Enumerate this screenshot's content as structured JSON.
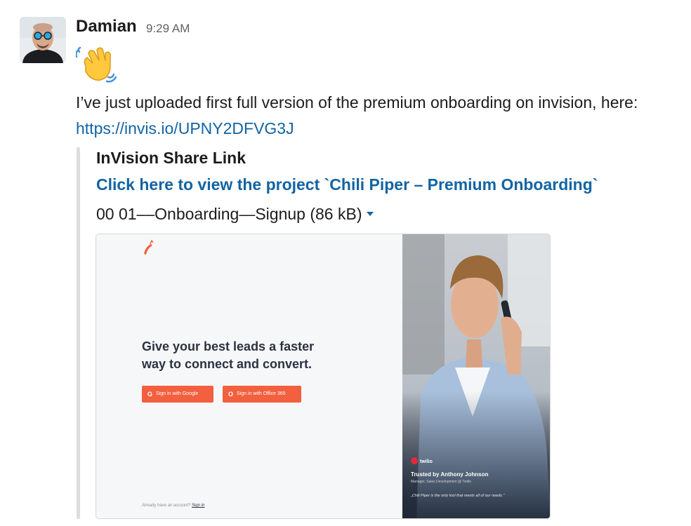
{
  "message": {
    "sender": "Damian",
    "time": "9:29 AM",
    "emoji": "waving-hand",
    "text_before_link": "I’ve just uploaded first full version of the premium onboarding on invision, here: ",
    "link": "https://invis.io/UPNY2DFVG3J"
  },
  "attachment": {
    "title": "InVision Share Link",
    "link_text": "Click here to view the project `Chili Piper – Premium Onboarding`",
    "file_name": "00 01––Onboarding—Signup (86 kB)",
    "preview": {
      "headline_line1": "Give your best leads a faster",
      "headline_line2": "way to connect and convert.",
      "google_button": "Sign in with Google",
      "office_button": "Sign in with Office 365",
      "footer_text": "Already have an account?",
      "footer_link": "Sign in",
      "brand": "twilio",
      "trusted_by": "Trusted by Anthony Johnson",
      "trusted_role": "Manager, Sales Development @ Twilio",
      "quote": "„Chili Piper is the only tool that meets all of our needs.”"
    }
  },
  "colors": {
    "link": "#1264a3",
    "accent_button": "#f2603f",
    "quote_bar": "#dddddd"
  }
}
